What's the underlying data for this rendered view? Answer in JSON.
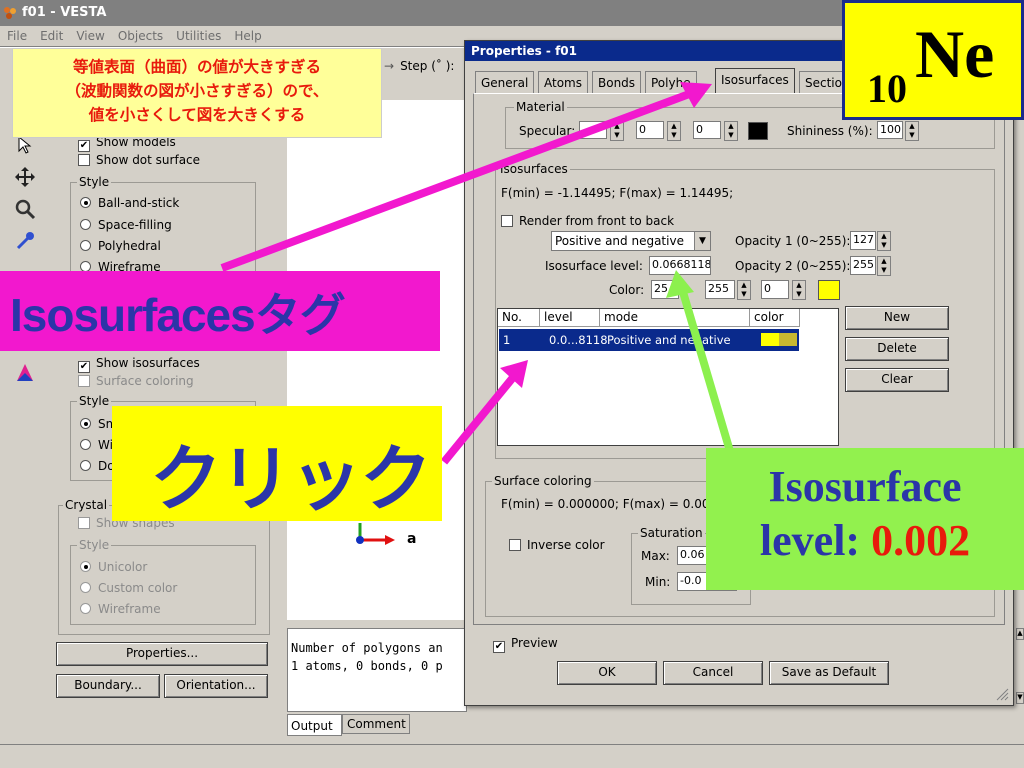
{
  "window": {
    "title": "f01 - VESTA"
  },
  "menu": [
    "File",
    "Edit",
    "View",
    "Objects",
    "Utilities",
    "Help"
  ],
  "step_label": "Step (˚ ):",
  "left_panel": {
    "show_models": "Show models",
    "show_dot_surface": "Show dot surface",
    "style_legend": "Style",
    "styles": [
      "Ball-and-stick",
      "Space-filling",
      "Polyhedral",
      "Wireframe"
    ],
    "show_isosurfaces": "Show isosurfaces",
    "surface_coloring": "Surface coloring",
    "style2_legend": "Style",
    "styles2": [
      "Sm",
      "Wi",
      "Do"
    ],
    "crystal_legend": "Crystal",
    "show_shapes": "Show shapes",
    "style3_legend": "Style",
    "styles3": [
      "Unicolor",
      "Custom color",
      "Wireframe"
    ],
    "properties_btn": "Properties...",
    "boundary_btn": "Boundary...",
    "orientation_btn": "Orientation..."
  },
  "canvas": {
    "axis_label": "a"
  },
  "log": {
    "lines": [
      "Number of polygons an",
      "1 atoms, 0 bonds, 0 p"
    ],
    "tabs": [
      "Output",
      "Comment"
    ]
  },
  "dialog": {
    "title": "Properties - f01",
    "tabs": [
      "General",
      "Atoms",
      "Bonds",
      "Polyhe",
      "Isosurfaces",
      "Sectio"
    ],
    "material_legend": "Material",
    "specular_label": "Specular:",
    "specular_values": [
      "",
      "0",
      "0"
    ],
    "shininess_label": "Shininess (%):",
    "shininess_value": "100",
    "iso_legend": "Isosurfaces",
    "fminmax": "F(min) = -1.14495;    F(max) = 1.14495;",
    "render_front": "Render from front to back",
    "mode_select": "Positive and negative",
    "opacity1_label": "Opacity 1 (0~255):",
    "opacity1_value": "127",
    "level_label": "Isosurface level:",
    "level_value": "0.0668118",
    "opacity2_label": "Opacity 2 (0~255):",
    "opacity2_value": "255",
    "color_label": "Color:",
    "color_values": [
      "25",
      "255",
      "0"
    ],
    "list_headers": [
      "No.",
      "level",
      "mode",
      "color"
    ],
    "list_row": {
      "no": "1",
      "level": "0.0...8118",
      "mode": "Positive and negative"
    },
    "new_btn": "New",
    "delete_btn": "Delete",
    "clear_btn": "Clear",
    "sc_legend": "Surface coloring",
    "sc_fminmax": "F(min) = 0.000000;    F(max) = 0.00",
    "inverse_color": "Inverse color",
    "saturation_legend": "Saturation",
    "max_label": "Max:",
    "max_value": "0.06",
    "min_label": "Min:",
    "min_value": "-0.0",
    "preview": "Preview",
    "ok_btn": "OK",
    "cancel_btn": "Cancel",
    "save_default_btn": "Save as Default"
  },
  "overlays": {
    "jp_note": [
      "等値表面（曲面）の値が大きすぎる",
      "（波動関数の図が小さすぎる）ので、",
      "値を小さくして図を大きくする"
    ],
    "iso_tag": "Isosurfacesタグ",
    "click": "クリック",
    "element_sub": "10",
    "element_sym": "Ne",
    "level_note_1": "Isosurface",
    "level_note_2": "level: ",
    "level_note_value": "0.002"
  },
  "colors": {
    "magenta_arrow": "#f218ce",
    "green_arrow": "#8cf04e",
    "yellow": "#ffff00",
    "selection_blue": "#0a2a8c"
  }
}
